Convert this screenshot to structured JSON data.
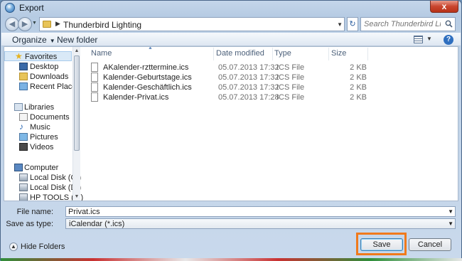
{
  "window": {
    "title": "Export",
    "close_label": "x"
  },
  "address": {
    "crumb": "Thunderbird Lighting"
  },
  "search": {
    "placeholder": "Search Thunderbird Lighting"
  },
  "toolbar": {
    "organize_label": "Organize",
    "new_folder_label": "New folder",
    "help_label": "?"
  },
  "sidebar": {
    "groups": [
      {
        "label": "Favorites",
        "icon": "star-icon",
        "items": [
          {
            "label": "Desktop",
            "icon": "desktop-icon"
          },
          {
            "label": "Downloads",
            "icon": "downloads-icon"
          },
          {
            "label": "Recent Places",
            "icon": "recent-places-icon"
          }
        ]
      },
      {
        "label": "Libraries",
        "icon": "libraries-icon",
        "items": [
          {
            "label": "Documents",
            "icon": "documents-icon"
          },
          {
            "label": "Music",
            "icon": "music-icon"
          },
          {
            "label": "Pictures",
            "icon": "pictures-icon"
          },
          {
            "label": "Videos",
            "icon": "videos-icon"
          }
        ]
      },
      {
        "label": "Computer",
        "icon": "computer-icon",
        "items": [
          {
            "label": "Local Disk (C:)",
            "icon": "disk-icon"
          },
          {
            "label": "Local Disk (D:)",
            "icon": "disk-icon"
          },
          {
            "label": "HP TOOLS (F:)",
            "icon": "disk-icon"
          }
        ]
      }
    ]
  },
  "files": {
    "columns": [
      "Name",
      "Date modified",
      "Type",
      "Size"
    ],
    "rows": [
      {
        "name": "AKalender-rzttermine.ics",
        "date": "05.07.2013 17:32",
        "type": "ICS File",
        "size": "2 KB"
      },
      {
        "name": "Kalender-Geburtstage.ics",
        "date": "05.07.2013 17:32",
        "type": "ICS File",
        "size": "2 KB"
      },
      {
        "name": "Kalender-Geschäftlich.ics",
        "date": "05.07.2013 17:32",
        "type": "ICS File",
        "size": "2 KB"
      },
      {
        "name": "Kalender-Privat.ics",
        "date": "05.07.2013 17:28",
        "type": "ICS File",
        "size": "2 KB"
      }
    ]
  },
  "save_form": {
    "filename_label": "File name:",
    "filename_value": "Privat.ics",
    "type_label": "Save as type:",
    "type_value": "iCalendar (*.ics)"
  },
  "footer": {
    "hide_folders_label": "Hide Folders",
    "save_label": "Save",
    "cancel_label": "Cancel"
  },
  "colors": {
    "highlight": "#f07a1c",
    "accent": "#3c7fb1"
  }
}
